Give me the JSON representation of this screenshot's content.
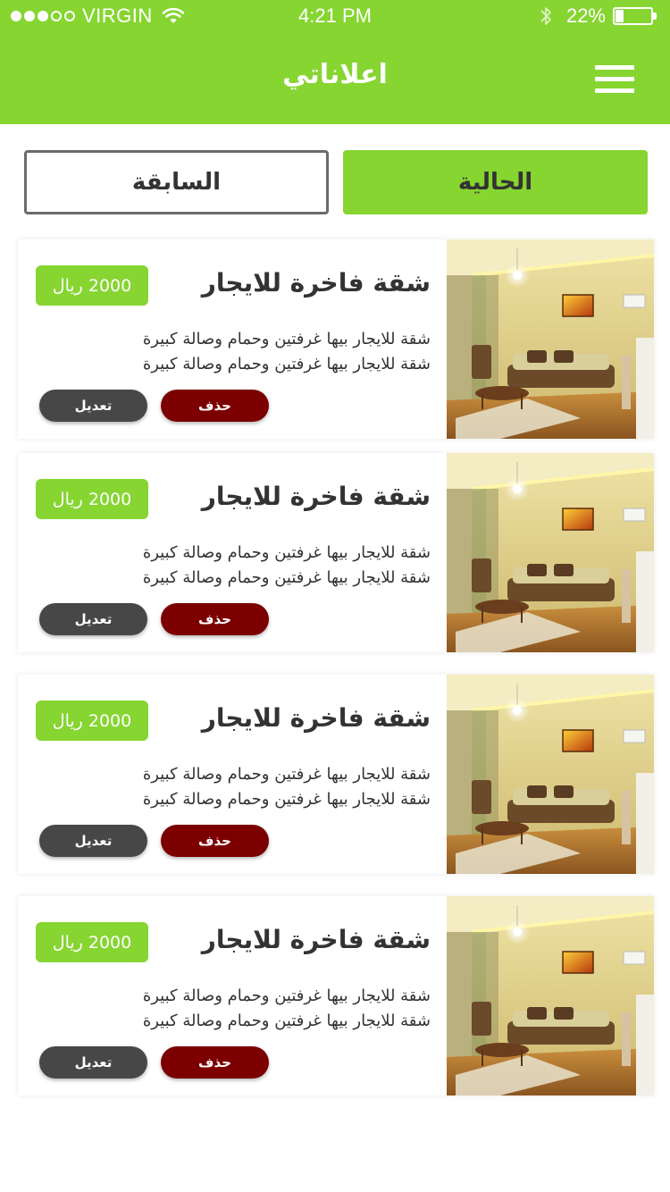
{
  "status_bar": {
    "carrier": "VIRGIN",
    "signal_filled": 3,
    "signal_total": 5,
    "time": "4:21 PM",
    "battery_percent": "22%",
    "battery_level": 0.22
  },
  "nav": {
    "title": "اعلاناتي",
    "menu_icon": "hamburger-menu-icon"
  },
  "tabs": {
    "current": "الحالية",
    "previous": "السابقة",
    "active": "current"
  },
  "listings": [
    {
      "title": "شقة فاخرة للايجار",
      "price": "2000 ريال",
      "desc_line1": "شقة  للايجار بيها غرفتين وحمام وصالة كبيرة",
      "desc_line2": "شقة  للايجار بيها غرفتين وحمام وصالة كبيرة",
      "delete_label": "حذف",
      "edit_label": "تعديل"
    },
    {
      "title": "شقة فاخرة للايجار",
      "price": "2000 ريال",
      "desc_line1": "شقة  للايجار بيها غرفتين وحمام وصالة كبيرة",
      "desc_line2": "شقة  للايجار بيها غرفتين وحمام وصالة كبيرة",
      "delete_label": "حذف",
      "edit_label": "تعديل"
    },
    {
      "title": "شقة فاخرة للايجار",
      "price": "2000 ريال",
      "desc_line1": "شقة  للايجار بيها غرفتين وحمام وصالة كبيرة",
      "desc_line2": "شقة  للايجار بيها غرفتين وحمام وصالة كبيرة",
      "delete_label": "حذف",
      "edit_label": "تعديل"
    },
    {
      "title": "شقة فاخرة للايجار",
      "price": "2000 ريال",
      "desc_line1": "شقة  للايجار بيها غرفتين وحمام وصالة كبيرة",
      "desc_line2": "شقة  للايجار بيها غرفتين وحمام وصالة كبيرة",
      "delete_label": "حذف",
      "edit_label": "تعديل"
    }
  ],
  "colors": {
    "brand_green": "#86d531",
    "delete_red": "#7c0000",
    "edit_gray": "#474747"
  }
}
